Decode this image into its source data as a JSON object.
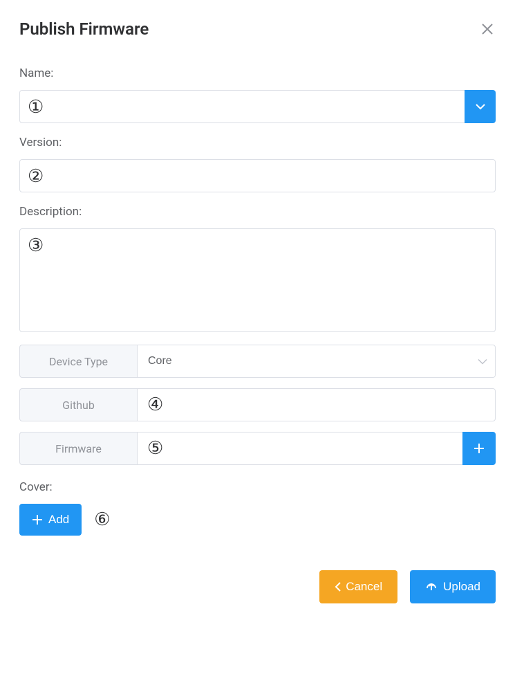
{
  "dialog": {
    "title": "Publish Firmware"
  },
  "fields": {
    "name": {
      "label": "Name:",
      "value": "",
      "marker": "①"
    },
    "version": {
      "label": "Version:",
      "value": "",
      "marker": "②"
    },
    "description": {
      "label": "Description:",
      "value": "",
      "marker": "③"
    },
    "deviceType": {
      "label": "Device Type",
      "value": "Core"
    },
    "github": {
      "label": "Github",
      "value": "",
      "marker": "④"
    },
    "firmware": {
      "label": "Firmware",
      "value": "",
      "marker": "⑤"
    },
    "cover": {
      "label": "Cover:",
      "addLabel": "Add",
      "marker": "⑥"
    }
  },
  "buttons": {
    "cancel": "Cancel",
    "upload": "Upload"
  }
}
